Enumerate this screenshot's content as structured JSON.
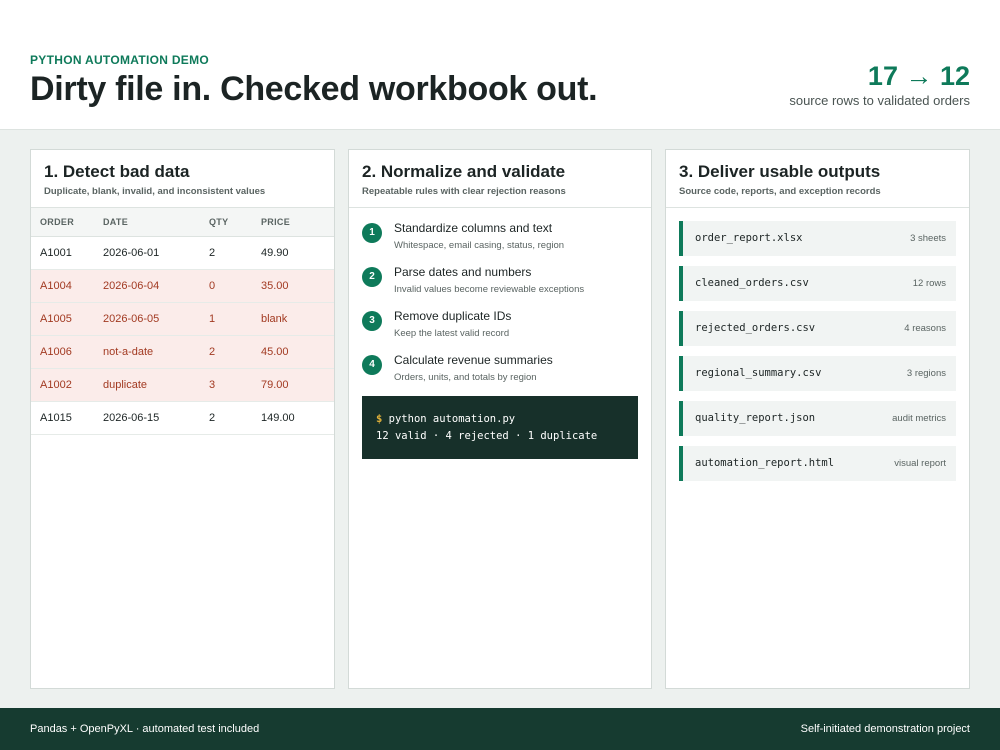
{
  "header": {
    "eyebrow": "PYTHON AUTOMATION DEMO",
    "title": "Dirty file in. Checked workbook out.",
    "stat_value": "17 → 12",
    "stat_label": "source rows to validated orders"
  },
  "detect": {
    "title": "1. Detect bad data",
    "subtitle": "Duplicate, blank, invalid, and inconsistent values",
    "columns": [
      "ORDER",
      "DATE",
      "QTY",
      "PRICE"
    ],
    "rows": [
      {
        "order": "A1001",
        "date": "2026-06-01",
        "qty": "2",
        "price": "49.90",
        "flagged": false
      },
      {
        "order": "A1004",
        "date": "2026-06-04",
        "qty": "0",
        "price": "35.00",
        "flagged": true
      },
      {
        "order": "A1005",
        "date": "2026-06-05",
        "qty": "1",
        "price": "blank",
        "flagged": true
      },
      {
        "order": "A1006",
        "date": "not-a-date",
        "qty": "2",
        "price": "45.00",
        "flagged": true
      },
      {
        "order": "A1002",
        "date": "duplicate",
        "qty": "3",
        "price": "79.00",
        "flagged": true
      },
      {
        "order": "A1015",
        "date": "2026-06-15",
        "qty": "2",
        "price": "149.00",
        "flagged": false
      }
    ]
  },
  "normalize": {
    "title": "2. Normalize and validate",
    "subtitle": "Repeatable rules with clear rejection reasons",
    "steps": [
      {
        "num": "1",
        "title": "Standardize columns and text",
        "desc": "Whitespace, email casing, status, region"
      },
      {
        "num": "2",
        "title": "Parse dates and numbers",
        "desc": "Invalid values become reviewable exceptions"
      },
      {
        "num": "3",
        "title": "Remove duplicate IDs",
        "desc": "Keep the latest valid record"
      },
      {
        "num": "4",
        "title": "Calculate revenue summaries",
        "desc": "Orders, units, and totals by region"
      }
    ],
    "terminal": {
      "prompt": "$",
      "command": "python automation.py",
      "output": "12 valid · 4 rejected · 1 duplicate"
    }
  },
  "deliver": {
    "title": "3. Deliver usable outputs",
    "subtitle": "Source code, reports, and exception records",
    "files": [
      {
        "name": "order_report.xlsx",
        "meta": "3 sheets"
      },
      {
        "name": "cleaned_orders.csv",
        "meta": "12 rows"
      },
      {
        "name": "rejected_orders.csv",
        "meta": "4 reasons"
      },
      {
        "name": "regional_summary.csv",
        "meta": "3 regions"
      },
      {
        "name": "quality_report.json",
        "meta": "audit metrics"
      },
      {
        "name": "automation_report.html",
        "meta": "visual report"
      }
    ]
  },
  "footer": {
    "left": "Pandas + OpenPyXL · automated test included",
    "right": "Self-initiated demonstration project"
  },
  "colors": {
    "accent": "#0e7a5a",
    "flagged_row_bg": "#fbecea",
    "flagged_text": "#a23a22",
    "terminal_bg": "#17302a",
    "footer_bg": "#163b30"
  }
}
